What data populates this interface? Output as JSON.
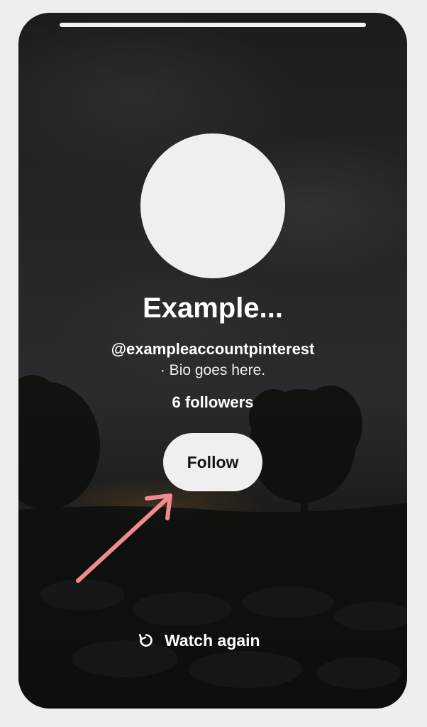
{
  "story": {
    "progress": 1.0
  },
  "profile": {
    "name": "Example...",
    "handle": "@exampleaccountpinterest",
    "bio": "· Bio goes here.",
    "followers": "6 followers"
  },
  "actions": {
    "follow_label": "Follow",
    "watch_again_label": "Watch again",
    "watch_again_icon": "replay-icon"
  },
  "annotation": {
    "arrow_color": "#f08a90",
    "arrow_icon": "pointer-arrow-icon"
  },
  "colors": {
    "page_background": "#eeeeee",
    "button_background": "#efefef",
    "avatar_background": "#efeff0",
    "text_light": "#ffffff"
  }
}
